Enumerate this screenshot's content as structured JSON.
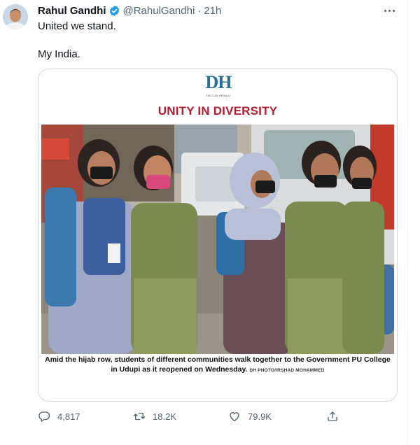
{
  "tweet": {
    "author": {
      "display_name": "Rahul Gandhi",
      "handle": "@RahulGandhi",
      "verified": true,
      "time": "21h"
    },
    "text_lines": [
      "United we stand.",
      "My India."
    ],
    "media": {
      "logo_text": "DH",
      "logo_subtext": "DECCAN HERALD",
      "headline": "UNITY IN DIVERSITY",
      "caption": "Amid the hijab row, students of different communities walk together to the Government PU College in Udupi as it reopened on Wednesday.",
      "credit": "DH PHOTO/IRSHAD MOHAMMED"
    },
    "stats": {
      "replies": "4,817",
      "retweets": "18.2K",
      "likes": "79.9K"
    },
    "icons": {
      "verified": "verified-badge-icon",
      "more": "more-dots-icon",
      "reply": "reply-icon",
      "retweet": "retweet-icon",
      "like": "heart-icon",
      "share": "share-icon"
    },
    "colors": {
      "verified_blue": "#1d9bf0",
      "secondary_text": "#536471",
      "headline_red": "#b01e2f",
      "logo_blue": "#2a6f95"
    }
  }
}
